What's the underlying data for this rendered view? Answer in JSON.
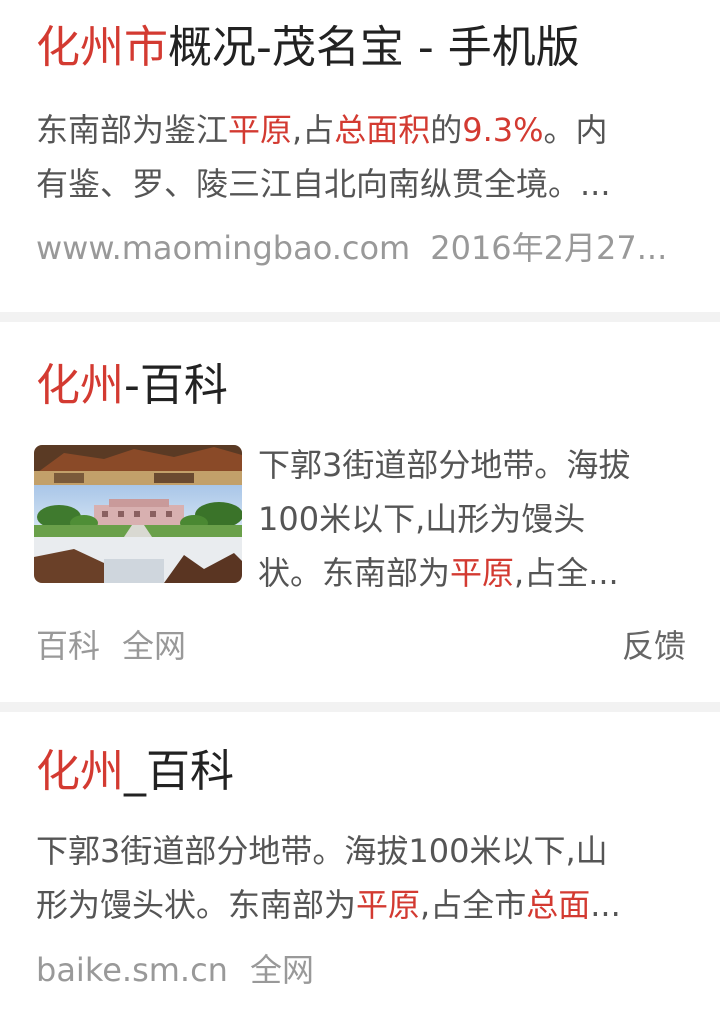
{
  "results": [
    {
      "title_hl": "化州市",
      "title_rest": "概况-茂名宝 - 手机版",
      "snippet": {
        "l1_a": "东南部为鉴江",
        "l1_b": "平原",
        "l1_c": ",占",
        "l1_d": "总面积",
        "l1_e": "的",
        "l1_f": "9.3%",
        "l1_g": "。内",
        "l2": "有鉴、罗、陵三江自北向南纵贯全境。..."
      },
      "source": "www.maomingbao.com",
      "date": "2016年2月27..."
    },
    {
      "title_hl": "化州",
      "title_rest": "-百科",
      "snippet": {
        "l1": "下郭3街道部分地带。海拔",
        "l2": "100米以下,山形为馒头",
        "l3_a": "状。东南部为",
        "l3_b": "平原",
        "l3_c": ",占全..."
      },
      "tag1": "百科",
      "tag2": "全网",
      "feedback": "反馈"
    },
    {
      "title_hl": "化州",
      "title_rest": "_百科",
      "snippet": {
        "l1": "下郭3街道部分地带。海拔100米以下,山",
        "l2_a": "形为馒头状。东南部为",
        "l2_b": "平原",
        "l2_c": ",占全市",
        "l2_d": "总面",
        "l2_e": "..."
      },
      "source": "baike.sm.cn",
      "tag": "全网"
    }
  ],
  "colors": {
    "highlight": "#d33a31",
    "title": "#222222",
    "snippet": "#555555",
    "meta": "#999999",
    "divider": "#f2f2f2"
  }
}
